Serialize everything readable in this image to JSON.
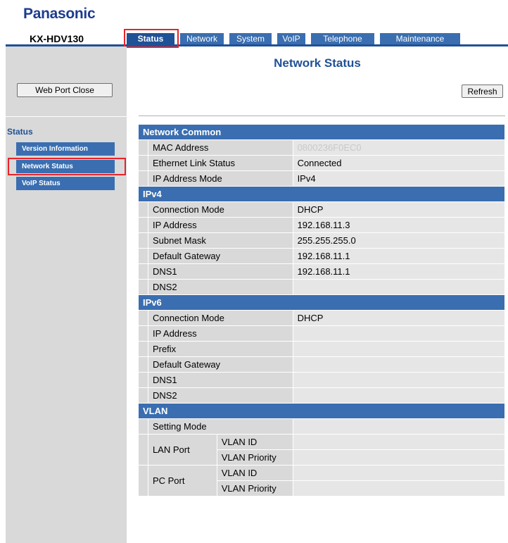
{
  "brand": "Panasonic",
  "model": "KX-HDV130",
  "tabs": [
    "Status",
    "Network",
    "System",
    "VoIP",
    "Telephone",
    "Maintenance"
  ],
  "buttons": {
    "web_port_close": "Web Port Close",
    "refresh": "Refresh"
  },
  "sidebar": {
    "title": "Status",
    "items": [
      "Version Information",
      "Network Status",
      "VoIP Status"
    ]
  },
  "page_title": "Network Status",
  "sections": {
    "network_common": {
      "title": "Network Common",
      "mac_label": "MAC Address",
      "mac_value": "0800236F0EC0",
      "link_label": "Ethernet Link Status",
      "link_value": "Connected",
      "mode_label": "IP Address Mode",
      "mode_value": "IPv4"
    },
    "ipv4": {
      "title": "IPv4",
      "conn_label": "Connection Mode",
      "conn_value": "DHCP",
      "ip_label": "IP Address",
      "ip_value": "192.168.11.3",
      "mask_label": "Subnet Mask",
      "mask_value": "255.255.255.0",
      "gw_label": "Default Gateway",
      "gw_value": "192.168.11.1",
      "dns1_label": "DNS1",
      "dns1_value": "192.168.11.1",
      "dns2_label": "DNS2",
      "dns2_value": ""
    },
    "ipv6": {
      "title": "IPv6",
      "conn_label": "Connection Mode",
      "conn_value": "DHCP",
      "ip_label": "IP Address",
      "ip_value": "",
      "prefix_label": "Prefix",
      "prefix_value": "",
      "gw_label": "Default Gateway",
      "gw_value": "",
      "dns1_label": "DNS1",
      "dns1_value": "",
      "dns2_label": "DNS2",
      "dns2_value": ""
    },
    "vlan": {
      "title": "VLAN",
      "setting_label": "Setting Mode",
      "lan_port": "LAN Port",
      "pc_port": "PC Port",
      "vlan_id": "VLAN ID",
      "vlan_priority": "VLAN Priority"
    }
  },
  "colors": {
    "brand_blue": "#1d3c8f",
    "nav_blue": "#1f5196",
    "section_blue": "#3a6eb0",
    "highlight_red": "#e8232a"
  }
}
